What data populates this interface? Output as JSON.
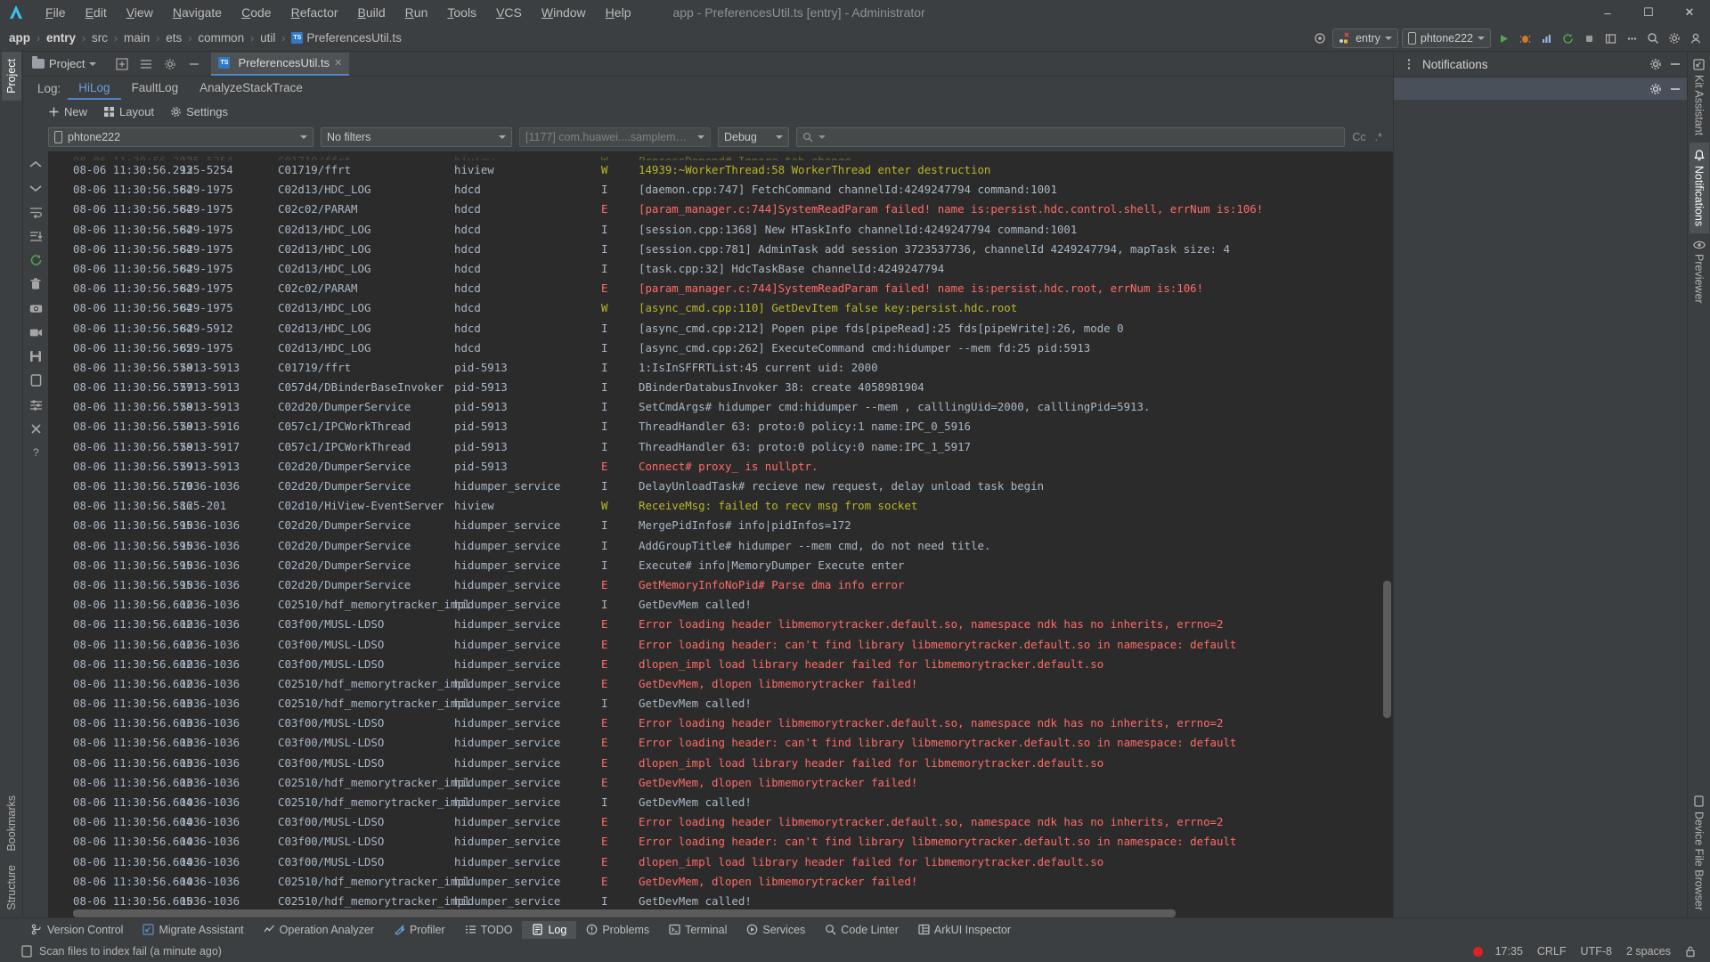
{
  "window": {
    "title": "app - PreferencesUtil.ts [entry] - Administrator",
    "minimize": "–",
    "maximize": "☐",
    "close": "✕"
  },
  "menu": [
    "File",
    "Edit",
    "View",
    "Navigate",
    "Code",
    "Refactor",
    "Build",
    "Run",
    "Tools",
    "VCS",
    "Window",
    "Help"
  ],
  "breadcrumb": {
    "items": [
      "app",
      "entry",
      "src",
      "main",
      "ets",
      "common",
      "util"
    ],
    "file": "PreferencesUtil.ts",
    "ts_badge": "TS",
    "separator": "›"
  },
  "toolbar": {
    "target_icon": "target-icon",
    "run_config": "entry",
    "device": "phtone222",
    "icons": [
      "run-icon",
      "debug-icon",
      "profile-icon",
      "rerun-icon",
      "stop-icon",
      "layout-icon",
      "more-icon",
      "search-icon",
      "settings-icon",
      "account-icon"
    ]
  },
  "editor_tabs": {
    "project_label": "Project",
    "file_tab": "PreferencesUtil.ts",
    "close_label": "✕"
  },
  "left_rail": {
    "project": "Project",
    "bookmarks": "Bookmarks",
    "structure": "Structure"
  },
  "right_rail": {
    "kit_assistant": "Kit Assistant",
    "notifications": "Notifications",
    "previewer": "Previewer",
    "device_file_browser": "Device File Browser"
  },
  "log_panel": {
    "label": "Log:",
    "tabs": [
      {
        "label": "HiLog",
        "active": true
      },
      {
        "label": "FaultLog",
        "active": false
      },
      {
        "label": "AnalyzeStackTrace",
        "active": false
      }
    ],
    "actions": [
      {
        "label": "New",
        "icon": "plus-icon"
      },
      {
        "label": "Layout",
        "icon": "layout-icon"
      },
      {
        "label": "Settings",
        "icon": "gear-icon"
      }
    ],
    "filters": {
      "device": "phtone222",
      "device_icon": "phone-icon",
      "filters": "No filters",
      "process": "[1177] com.huawei....samplemanagement",
      "level": "Debug",
      "search_placeholder": "",
      "search_icon": "search-icon",
      "match_case": "Cc",
      "regex": ".*"
    }
  },
  "right_panel": {
    "title": "Notifications",
    "gear_icon": "gear-icon",
    "minimize_icon": "minimize-icon",
    "more_icon": "more-icon"
  },
  "columns": [
    "time",
    "pid",
    "tag",
    "package",
    "level",
    "message"
  ],
  "log_rows": [
    {
      "time": "08-06 11:30:56.293",
      "pid": "125-5254",
      "tag": "C01719/ffrt",
      "pkg": "hiview",
      "lvl": "W",
      "msg": "14939:~WorkerThread:58 WorkerThread enter destruction"
    },
    {
      "time": "08-06 11:30:56.564",
      "pid": "829-1975",
      "tag": "C02d13/HDC_LOG",
      "pkg": "hdcd",
      "lvl": "I",
      "msg": "[daemon.cpp:747] FetchCommand channelId:4249247794 command:1001"
    },
    {
      "time": "08-06 11:30:56.564",
      "pid": "829-1975",
      "tag": "C02c02/PARAM",
      "pkg": "hdcd",
      "lvl": "E",
      "msg": "[param_manager.c:744]SystemReadParam failed! name is:persist.hdc.control.shell, errNum is:106!"
    },
    {
      "time": "08-06 11:30:56.564",
      "pid": "829-1975",
      "tag": "C02d13/HDC_LOG",
      "pkg": "hdcd",
      "lvl": "I",
      "msg": "[session.cpp:1368] New HTaskInfo channelId:4249247794 command:1001"
    },
    {
      "time": "08-06 11:30:56.564",
      "pid": "829-1975",
      "tag": "C02d13/HDC_LOG",
      "pkg": "hdcd",
      "lvl": "I",
      "msg": "[session.cpp:781] AdminTask add session 3723537736, channelId 4249247794, mapTask size: 4"
    },
    {
      "time": "08-06 11:30:56.564",
      "pid": "829-1975",
      "tag": "C02d13/HDC_LOG",
      "pkg": "hdcd",
      "lvl": "I",
      "msg": "[task.cpp:32] HdcTaskBase channelId:4249247794"
    },
    {
      "time": "08-06 11:30:56.564",
      "pid": "829-1975",
      "tag": "C02c02/PARAM",
      "pkg": "hdcd",
      "lvl": "E",
      "msg": "[param_manager.c:744]SystemReadParam failed! name is:persist.hdc.root, errNum is:106!"
    },
    {
      "time": "08-06 11:30:56.564",
      "pid": "829-1975",
      "tag": "C02d13/HDC_LOG",
      "pkg": "hdcd",
      "lvl": "W",
      "msg": "[async_cmd.cpp:110] GetDevItem false key:persist.hdc.root"
    },
    {
      "time": "08-06 11:30:56.564",
      "pid": "829-5912",
      "tag": "C02d13/HDC_LOG",
      "pkg": "hdcd",
      "lvl": "I",
      "msg": "[async_cmd.cpp:212] Popen pipe fds[pipeRead]:25 fds[pipeWrite]:26, mode 0"
    },
    {
      "time": "08-06 11:30:56.565",
      "pid": "829-1975",
      "tag": "C02d13/HDC_LOG",
      "pkg": "hdcd",
      "lvl": "I",
      "msg": "[async_cmd.cpp:262] ExecuteCommand cmd:hidumper --mem fd:25 pid:5913"
    },
    {
      "time": "08-06 11:30:56.578",
      "pid": "5913-5913",
      "tag": "C01719/ffrt",
      "pkg": "pid-5913",
      "lvl": "I",
      "msg": "1:IsInSFFRTList:45 current uid: 2000"
    },
    {
      "time": "08-06 11:30:56.577",
      "pid": "5913-5913",
      "tag": "C057d4/DBinderBaseInvoker",
      "pkg": "pid-5913",
      "lvl": "I",
      "msg": "DBinderDatabusInvoker 38: create 4058981904"
    },
    {
      "time": "08-06 11:30:56.578",
      "pid": "5913-5913",
      "tag": "C02d20/DumperService",
      "pkg": "pid-5913",
      "lvl": "I",
      "msg": "SetCmdArgs# hidumper cmd:hidumper --mem , calllingUid=2000, calllingPid=5913."
    },
    {
      "time": "08-06 11:30:56.578",
      "pid": "5913-5916",
      "tag": "C057c1/IPCWorkThread",
      "pkg": "pid-5913",
      "lvl": "I",
      "msg": "ThreadHandler 63: proto:0 policy:1 name:IPC_0_5916"
    },
    {
      "time": "08-06 11:30:56.578",
      "pid": "5913-5917",
      "tag": "C057c1/IPCWorkThread",
      "pkg": "pid-5913",
      "lvl": "I",
      "msg": "ThreadHandler 63: proto:0 policy:0 name:IPC_1_5917"
    },
    {
      "time": "08-06 11:30:56.579",
      "pid": "5913-5913",
      "tag": "C02d20/DumperService",
      "pkg": "pid-5913",
      "lvl": "E",
      "msg": "Connect# proxy_ is nullptr."
    },
    {
      "time": "08-06 11:30:56.579",
      "pid": "1036-1036",
      "tag": "C02d20/DumperService",
      "pkg": "hidumper_service",
      "lvl": "I",
      "msg": "DelayUnloadTask# recieve new request, delay unload task begin"
    },
    {
      "time": "08-06 11:30:56.586",
      "pid": "125-201",
      "tag": "C02d10/HiView-EventServer",
      "pkg": "hiview",
      "lvl": "W",
      "msg": "ReceiveMsg: failed to recv msg from socket"
    },
    {
      "time": "08-06 11:30:56.595",
      "pid": "1036-1036",
      "tag": "C02d20/DumperService",
      "pkg": "hidumper_service",
      "lvl": "I",
      "msg": "MergePidInfos# info|pidInfos=172"
    },
    {
      "time": "08-06 11:30:56.595",
      "pid": "1036-1036",
      "tag": "C02d20/DumperService",
      "pkg": "hidumper_service",
      "lvl": "I",
      "msg": "AddGroupTitle# hidumper --mem cmd, do not need title."
    },
    {
      "time": "08-06 11:30:56.595",
      "pid": "1036-1036",
      "tag": "C02d20/DumperService",
      "pkg": "hidumper_service",
      "lvl": "I",
      "msg": "Execute# info|MemoryDumper Execute enter"
    },
    {
      "time": "08-06 11:30:56.595",
      "pid": "1036-1036",
      "tag": "C02d20/DumperService",
      "pkg": "hidumper_service",
      "lvl": "E",
      "msg": "GetMemoryInfoNoPid# Parse dma info error"
    },
    {
      "time": "08-06 11:30:56.602",
      "pid": "1036-1036",
      "tag": "C02510/hdf_memorytracker_impl",
      "pkg": "hidumper_service",
      "lvl": "I",
      "msg": "GetDevMem called!"
    },
    {
      "time": "08-06 11:30:56.602",
      "pid": "1036-1036",
      "tag": "C03f00/MUSL-LDSO",
      "pkg": "hidumper_service",
      "lvl": "E",
      "msg": "Error loading header libmemorytracker.default.so, namespace ndk has no inherits, errno=2"
    },
    {
      "time": "08-06 11:30:56.602",
      "pid": "1036-1036",
      "tag": "C03f00/MUSL-LDSO",
      "pkg": "hidumper_service",
      "lvl": "E",
      "msg": "Error loading header: can't find library libmemorytracker.default.so in namespace: default"
    },
    {
      "time": "08-06 11:30:56.602",
      "pid": "1036-1036",
      "tag": "C03f00/MUSL-LDSO",
      "pkg": "hidumper_service",
      "lvl": "E",
      "msg": "dlopen_impl load library header failed for libmemorytracker.default.so"
    },
    {
      "time": "08-06 11:30:56.602",
      "pid": "1036-1036",
      "tag": "C02510/hdf_memorytracker_impl",
      "pkg": "hidumper_service",
      "lvl": "E",
      "msg": "GetDevMem, dlopen libmemorytracker failed!"
    },
    {
      "time": "08-06 11:30:56.603",
      "pid": "1036-1036",
      "tag": "C02510/hdf_memorytracker_impl",
      "pkg": "hidumper_service",
      "lvl": "I",
      "msg": "GetDevMem called!"
    },
    {
      "time": "08-06 11:30:56.603",
      "pid": "1036-1036",
      "tag": "C03f00/MUSL-LDSO",
      "pkg": "hidumper_service",
      "lvl": "E",
      "msg": "Error loading header libmemorytracker.default.so, namespace ndk has no inherits, errno=2"
    },
    {
      "time": "08-06 11:30:56.603",
      "pid": "1036-1036",
      "tag": "C03f00/MUSL-LDSO",
      "pkg": "hidumper_service",
      "lvl": "E",
      "msg": "Error loading header: can't find library libmemorytracker.default.so in namespace: default"
    },
    {
      "time": "08-06 11:30:56.603",
      "pid": "1036-1036",
      "tag": "C03f00/MUSL-LDSO",
      "pkg": "hidumper_service",
      "lvl": "E",
      "msg": "dlopen_impl load library header failed for libmemorytracker.default.so"
    },
    {
      "time": "08-06 11:30:56.603",
      "pid": "1036-1036",
      "tag": "C02510/hdf_memorytracker_impl",
      "pkg": "hidumper_service",
      "lvl": "E",
      "msg": "GetDevMem, dlopen libmemorytracker failed!"
    },
    {
      "time": "08-06 11:30:56.604",
      "pid": "1036-1036",
      "tag": "C02510/hdf_memorytracker_impl",
      "pkg": "hidumper_service",
      "lvl": "I",
      "msg": "GetDevMem called!"
    },
    {
      "time": "08-06 11:30:56.604",
      "pid": "1036-1036",
      "tag": "C03f00/MUSL-LDSO",
      "pkg": "hidumper_service",
      "lvl": "E",
      "msg": "Error loading header libmemorytracker.default.so, namespace ndk has no inherits, errno=2"
    },
    {
      "time": "08-06 11:30:56.604",
      "pid": "1036-1036",
      "tag": "C03f00/MUSL-LDSO",
      "pkg": "hidumper_service",
      "lvl": "E",
      "msg": "Error loading header: can't find library libmemorytracker.default.so in namespace: default"
    },
    {
      "time": "08-06 11:30:56.604",
      "pid": "1036-1036",
      "tag": "C03f00/MUSL-LDSO",
      "pkg": "hidumper_service",
      "lvl": "E",
      "msg": "dlopen_impl load library header failed for libmemorytracker.default.so"
    },
    {
      "time": "08-06 11:30:56.604",
      "pid": "1036-1036",
      "tag": "C02510/hdf_memorytracker_impl",
      "pkg": "hidumper_service",
      "lvl": "E",
      "msg": "GetDevMem, dlopen libmemorytracker failed!"
    },
    {
      "time": "08-06 11:30:56.605",
      "pid": "1036-1036",
      "tag": "C02510/hdf_memorytracker_impl",
      "pkg": "hidumper_service",
      "lvl": "I",
      "msg": "GetDevMem called!"
    }
  ],
  "bottom_tools": [
    {
      "label": "Version Control",
      "icon": "branch-icon",
      "active": false
    },
    {
      "label": "Migrate Assistant",
      "icon": "migrate-icon",
      "active": false
    },
    {
      "label": "Operation Analyzer",
      "icon": "analyzer-icon",
      "active": false
    },
    {
      "label": "Profiler",
      "icon": "profiler-icon",
      "active": false
    },
    {
      "label": "TODO",
      "icon": "todo-icon",
      "active": false
    },
    {
      "label": "Log",
      "icon": "log-icon",
      "active": true
    },
    {
      "label": "Problems",
      "icon": "problems-icon",
      "active": false
    },
    {
      "label": "Terminal",
      "icon": "terminal-icon",
      "active": false
    },
    {
      "label": "Services",
      "icon": "services-icon",
      "active": false
    },
    {
      "label": "Code Linter",
      "icon": "linter-icon",
      "active": false
    },
    {
      "label": "ArkUI Inspector",
      "icon": "inspector-icon",
      "active": false
    }
  ],
  "status": {
    "message": "Scan files to index fail (a minute ago)",
    "message_icon": "document-icon",
    "time": "17:35",
    "line_sep": "CRLF",
    "encoding": "UTF-8",
    "indent": "2 spaces",
    "lock_icon": "lock-icon",
    "rec_indicator": "recording-dot"
  },
  "colors": {
    "accent": "#4a88c7",
    "error": "#ff6b68",
    "warn": "#bbb529",
    "info": "#a9b7c6",
    "panel": "#3c3f41",
    "editor": "#2b2b2b"
  }
}
